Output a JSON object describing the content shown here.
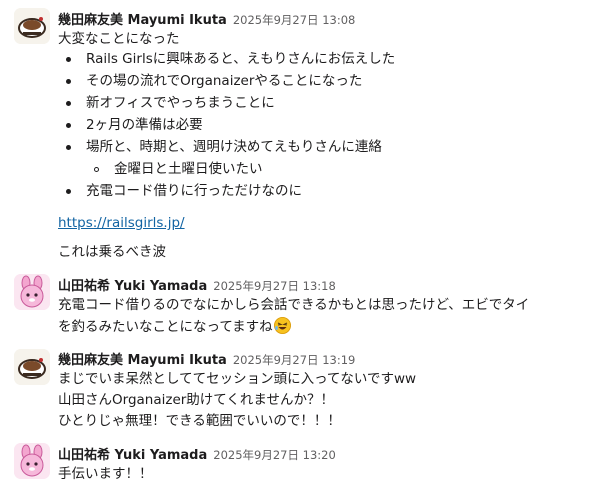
{
  "messages": [
    {
      "author": "幾田麻友美 Mayumi Ikuta",
      "time": "2025年9月27日 13:08",
      "intro": "大変なことになった",
      "bullets": [
        "Rails Girlsに興味あると、えもりさんにお伝えした",
        "その場の流れでOrganaizerやることになった",
        "新オフィスでやっちまうことに",
        "2ヶ月の準備は必要",
        "場所と、時期と、週明け決めてえもりさんに連絡",
        "充電コード借りに行っただけなのに"
      ],
      "sub_bullet": "金曜日と土曜日使いたい",
      "link": "https://railsgirls.jp/",
      "outro": "これは乗るべき波"
    },
    {
      "author": "山田祐希 Yuki Yamada",
      "time": "2025年9月27日 13:18",
      "lines": [
        "充電コード借りるのでなにかしら会話できるかもとは思ったけど、エビでタイ",
        "を釣るみたいなことになってますね"
      ],
      "emoji": "rolling-on-the-floor-laughing"
    },
    {
      "author": "幾田麻友美 Mayumi Ikuta",
      "time": "2025年9月27日 13:19",
      "lines": [
        "まじでいま呆然としててセッション頭に入ってないですww",
        "山田さんOrganaizer助けてくれませんか？！",
        "ひとりじゃ無理！できる範囲でいいので！！！"
      ]
    },
    {
      "author": "山田祐希 Yuki Yamada",
      "time": "2025年9月27日 13:20",
      "lines": [
        "手伝います！！"
      ]
    }
  ],
  "colors": {
    "link": "#1264a3",
    "text": "#1d1c1d",
    "timestamp": "#616061"
  }
}
